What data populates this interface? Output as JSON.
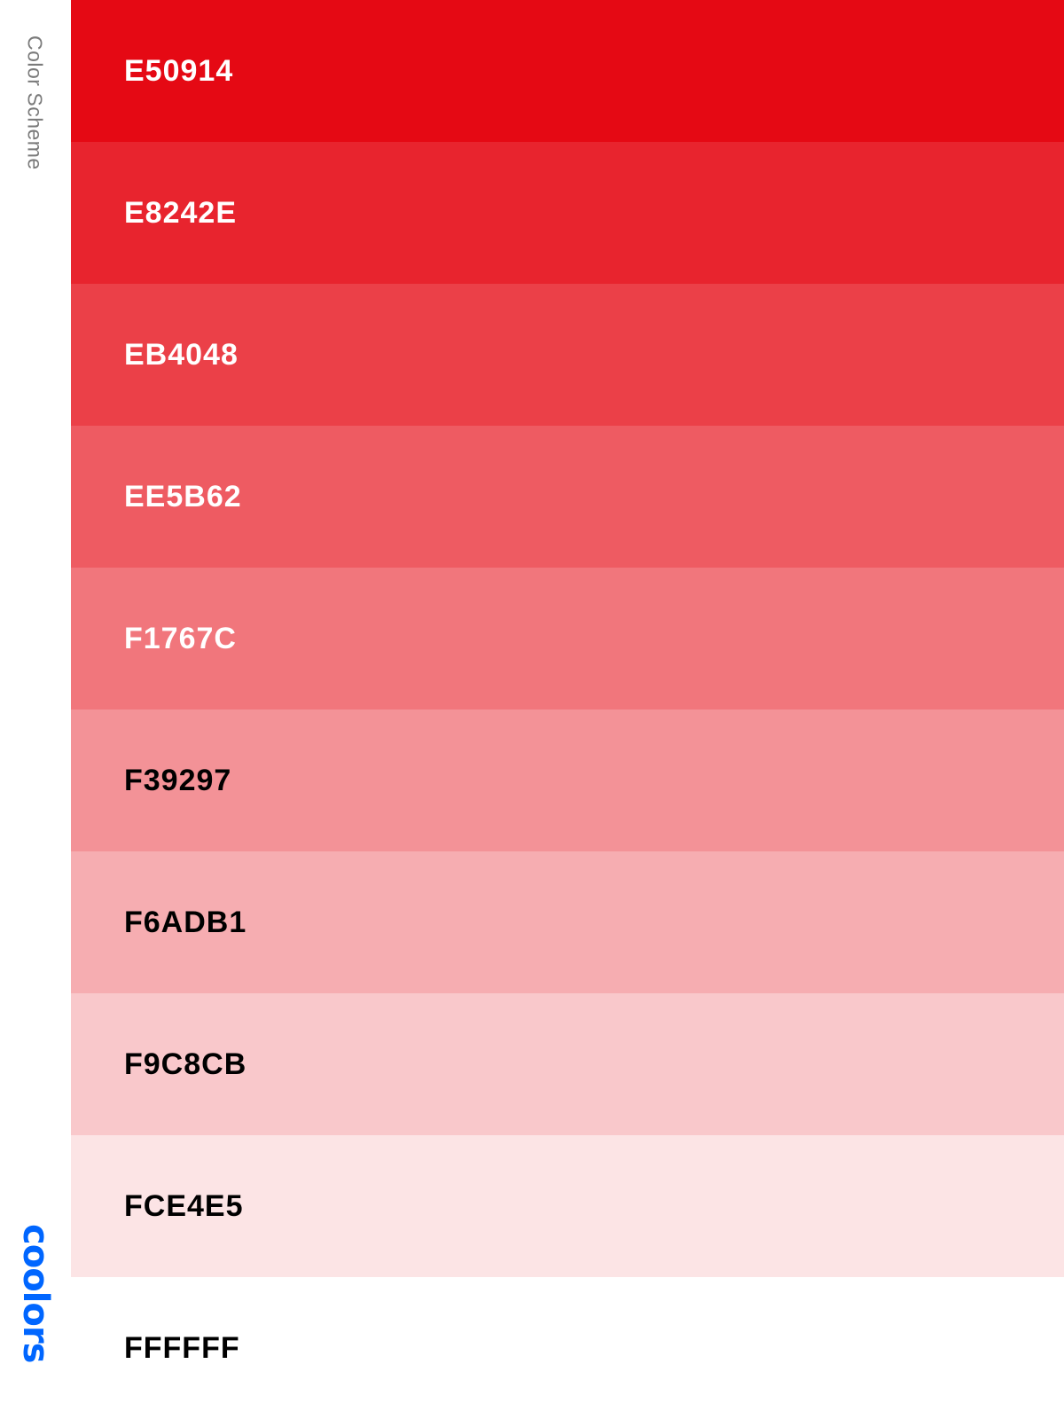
{
  "sidebar": {
    "title": "Color Scheme",
    "logo": "coolors",
    "logo_color": "#0066FF"
  },
  "swatches": [
    {
      "hex": "E50914",
      "color": "#E50914",
      "text_color": "#FFFFFF"
    },
    {
      "hex": "E8242E",
      "color": "#E8242E",
      "text_color": "#FFFFFF"
    },
    {
      "hex": "EB4048",
      "color": "#EB4048",
      "text_color": "#FFFFFF"
    },
    {
      "hex": "EE5B62",
      "color": "#EE5B62",
      "text_color": "#FFFFFF"
    },
    {
      "hex": "F1767C",
      "color": "#F1767C",
      "text_color": "#FFFFFF"
    },
    {
      "hex": "F39297",
      "color": "#F39297",
      "text_color": "#000000"
    },
    {
      "hex": "F6ADB1",
      "color": "#F6ADB1",
      "text_color": "#000000"
    },
    {
      "hex": "F9C8CB",
      "color": "#F9C8CB",
      "text_color": "#000000"
    },
    {
      "hex": "FCE4E5",
      "color": "#FCE4E5",
      "text_color": "#000000"
    },
    {
      "hex": "FFFFFF",
      "color": "#FFFFFF",
      "text_color": "#000000"
    }
  ]
}
